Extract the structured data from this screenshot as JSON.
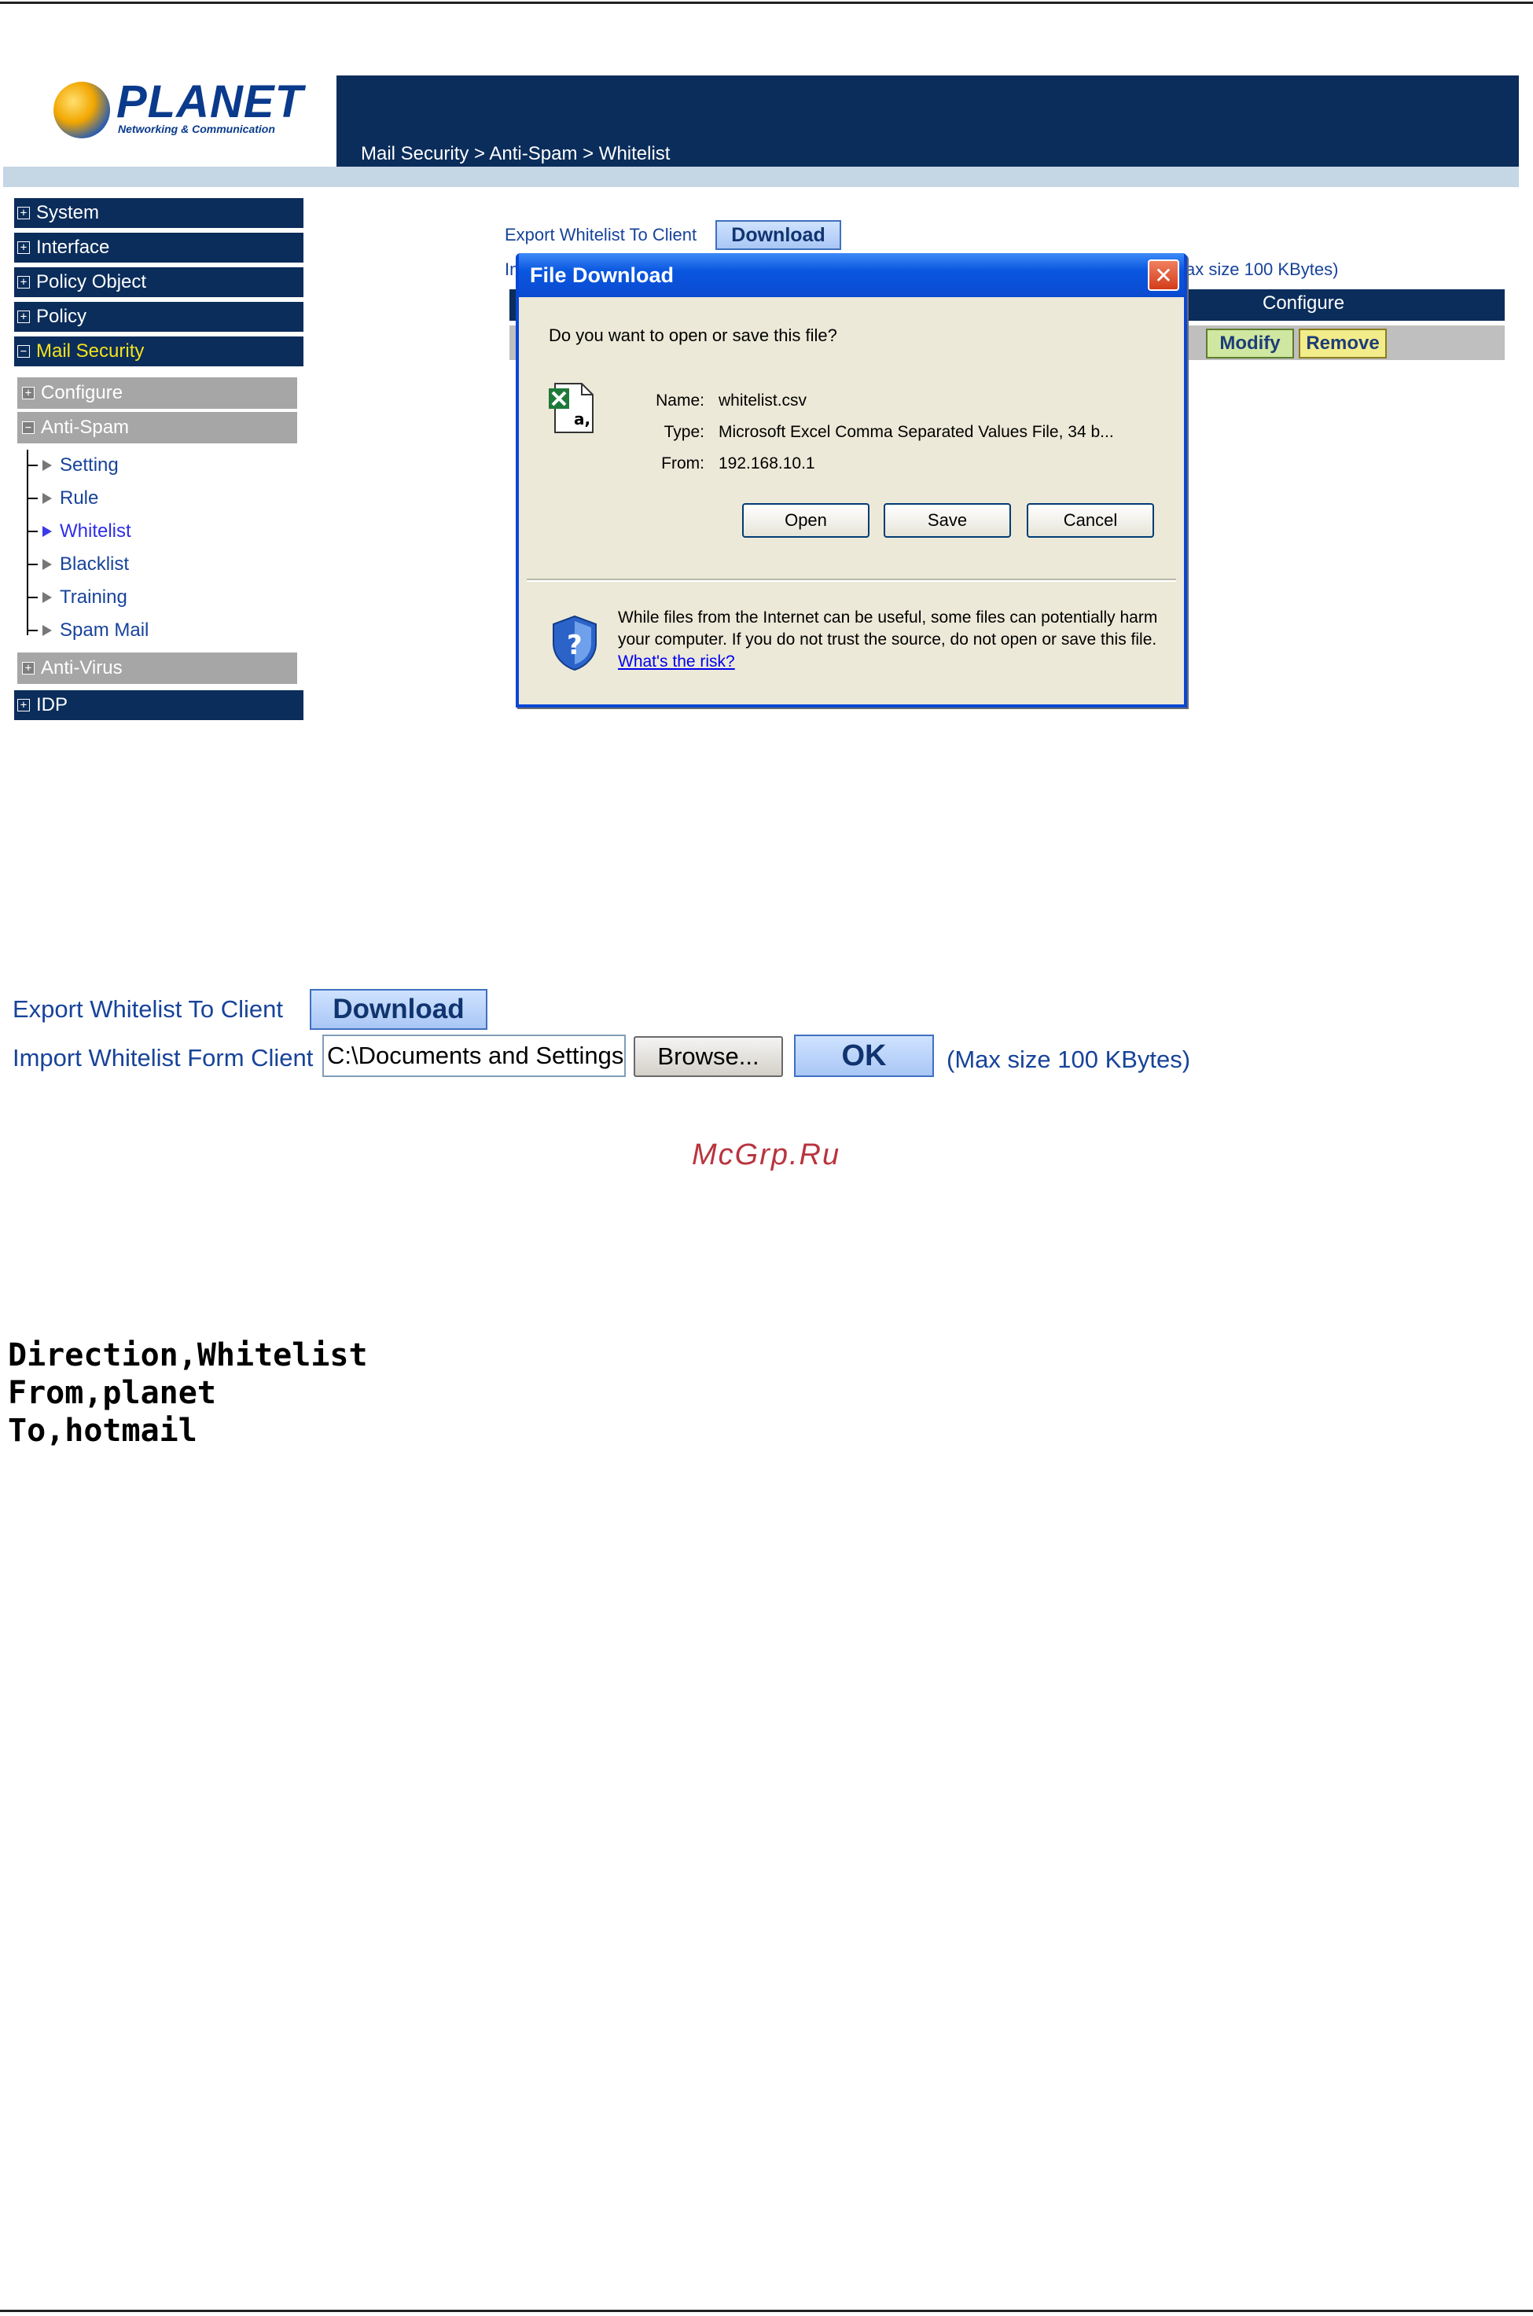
{
  "header": {
    "logo_text": "PLANET",
    "logo_sub": "Networking & Communication",
    "breadcrumb": "Mail Security > Anti-Spam > Whitelist"
  },
  "sidebar": {
    "items": [
      {
        "label": "System"
      },
      {
        "label": "Interface"
      },
      {
        "label": "Policy Object"
      },
      {
        "label": "Policy"
      },
      {
        "label": "Mail Security"
      }
    ],
    "sub_items": [
      {
        "label": "Configure"
      },
      {
        "label": "Anti-Spam"
      }
    ],
    "tree": [
      {
        "label": "Setting"
      },
      {
        "label": "Rule"
      },
      {
        "label": "Whitelist"
      },
      {
        "label": "Blacklist"
      },
      {
        "label": "Training"
      },
      {
        "label": "Spam Mail"
      }
    ],
    "anti_virus": "Anti-Virus",
    "idp": "IDP"
  },
  "top_form": {
    "export_label": "Export Whitelist To Client",
    "download_label": "Download",
    "import_prefix": "Im",
    "max_size_partial": "ax size 100 KBytes)",
    "configure_header": "Configure",
    "modify_label": "Modify",
    "remove_label": "Remove"
  },
  "dialog": {
    "title": "File Download",
    "close": "✕",
    "question": "Do you want to open or save this file?",
    "name_label": "Name:",
    "name_value": "whitelist.csv",
    "type_label": "Type:",
    "type_value": "Microsoft Excel Comma Separated Values File, 34 b...",
    "from_label": "From:",
    "from_value": "192.168.10.1",
    "open_label": "Open",
    "save_label": "Save",
    "cancel_label": "Cancel",
    "warning": "While files from the Internet can be useful, some files can potentially harm your computer. If you do not trust the source, do not open or save this file.",
    "risk_link": "What's the risk?"
  },
  "lower_form": {
    "export_label": "Export Whitelist To Client",
    "download_label": "Download",
    "import_label": "Import Whitelist Form Client",
    "path_value": "C:\\Documents and Settings",
    "browse_label": "Browse...",
    "ok_label": "OK",
    "max_size": "(Max size 100 KBytes)"
  },
  "watermark": "McGrp.Ru",
  "csv_lines": [
    "Direction,Whitelist",
    "From,planet",
    "To,hotmail"
  ]
}
